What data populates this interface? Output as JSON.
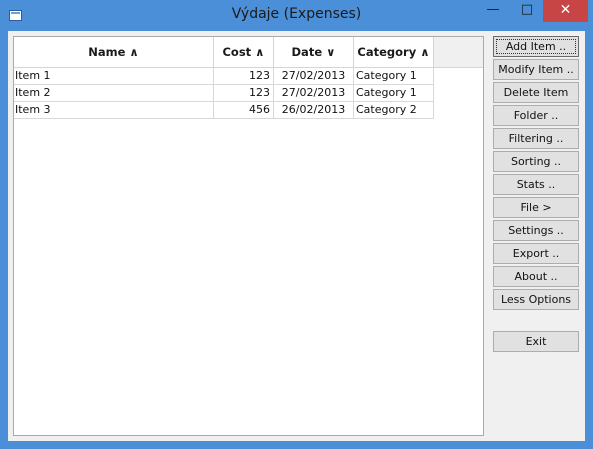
{
  "window": {
    "title": "Výdaje (Expenses)",
    "min_glyph": "—",
    "max_glyph": "□",
    "close_glyph": "✕"
  },
  "table": {
    "columns": [
      "Name ∧",
      "Cost ∧",
      "Date ∨",
      "Category ∧"
    ],
    "rows": [
      {
        "name": "Item 1",
        "cost": "123",
        "date": "27/02/2013",
        "category": "Category 1"
      },
      {
        "name": "Item 2",
        "cost": "123",
        "date": "27/02/2013",
        "category": "Category 1"
      },
      {
        "name": "Item 3",
        "cost": "456",
        "date": "26/02/2013",
        "category": "Category 2"
      }
    ]
  },
  "buttons": {
    "add_item": "Add Item ..",
    "modify_item": "Modify Item ..",
    "delete_item": "Delete Item",
    "folder": "Folder ..",
    "filtering": "Filtering ..",
    "sorting": "Sorting ..",
    "stats": "Stats ..",
    "file": "File >",
    "settings": "Settings ..",
    "export": "Export ..",
    "about": "About ..",
    "less_options": "Less Options",
    "exit": "Exit"
  },
  "colors": {
    "titlebar": "#4a8fd8",
    "close_button": "#c74545",
    "client_bg": "#f0f0f0"
  }
}
